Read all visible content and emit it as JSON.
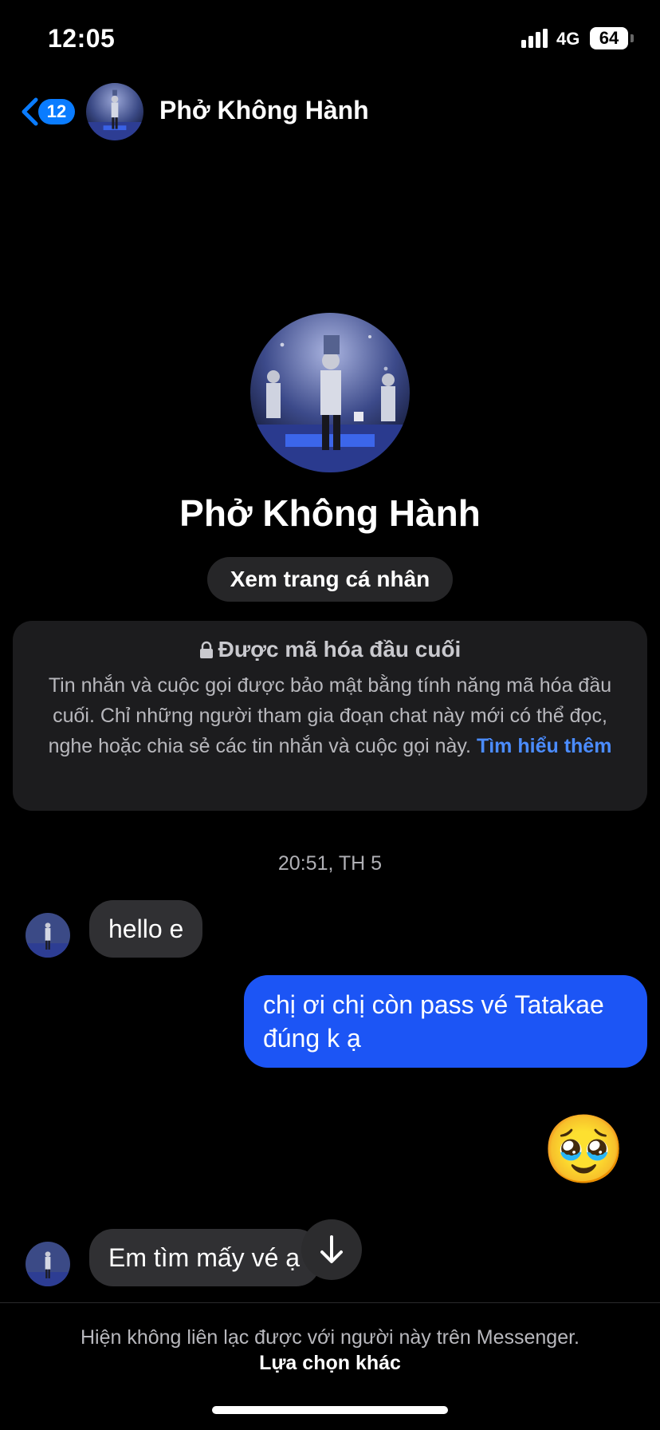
{
  "status_bar": {
    "time": "12:05",
    "network": "4G",
    "battery": "64"
  },
  "header": {
    "back_badge": "12",
    "contact_name": "Phở Không Hành"
  },
  "profile": {
    "name": "Phở Không Hành",
    "view_profile_label": "Xem trang cá nhân"
  },
  "encryption_notice": {
    "title": "Được mã hóa đầu cuối",
    "body": "Tin nhắn và cuộc gọi được bảo mật bằng tính năng mã hóa đầu cuối. Chỉ những người tham gia đoạn chat này mới có thể đọc, nghe hoặc chia sẻ các tin nhắn và cuộc gọi này.",
    "link": "Tìm hiểu thêm"
  },
  "conversation": {
    "timestamp": "20:51, TH 5",
    "messages": [
      {
        "direction": "incoming",
        "text": "hello e"
      },
      {
        "direction": "outgoing",
        "text": "chị ơi chị còn pass vé Tatakae đúng k ạ"
      },
      {
        "direction": "outgoing",
        "text": "🥹"
      },
      {
        "direction": "incoming",
        "text": "Em tìm mấy vé ạ"
      }
    ]
  },
  "footer": {
    "notice": "Hiện không liên lạc được với người này trên Messenger.",
    "link": "Lựa chọn khác"
  },
  "colors": {
    "background": "#000000",
    "accent": "#0a7cff",
    "outgoing_bubble": "#1c55f5",
    "incoming_bubble": "#303033",
    "card": "#1c1c1e",
    "link": "#4b8cff"
  },
  "icons": [
    "signal-icon",
    "chevron-left-icon",
    "lock-icon",
    "arrow-down-icon"
  ]
}
